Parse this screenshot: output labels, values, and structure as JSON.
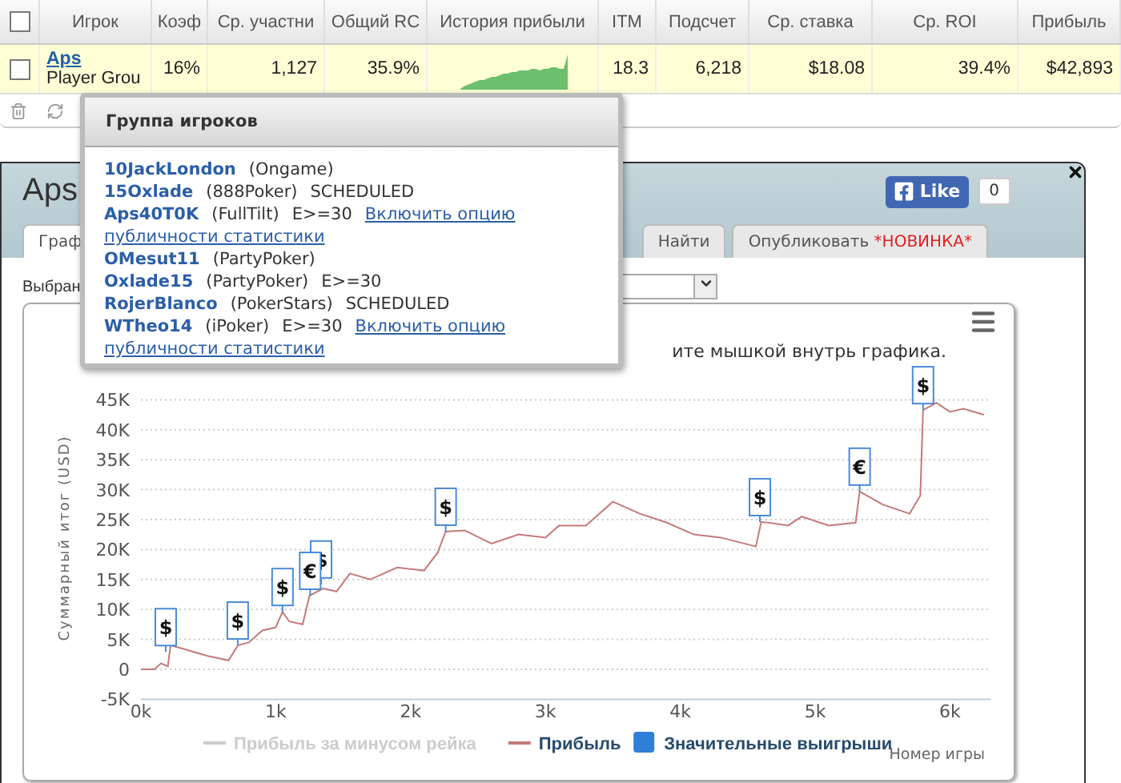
{
  "table": {
    "header_checkbox": {
      "checked": false
    },
    "columns": [
      "Игрок",
      "Коэф",
      "Ср. участни",
      "Общий RC",
      "История прибыли",
      "ITM",
      "Подсчет",
      "Ср. ставка",
      "Ср. ROI",
      "Прибыль"
    ],
    "rows": [
      {
        "checked": false,
        "player": "Aps",
        "group": "Player Grou",
        "coef": "16%",
        "avg_players": "1,127",
        "total_roi": "35.9%",
        "itm": "18.3",
        "count": "6,218",
        "avg_stake": "$18.08",
        "avg_roi": "39.4%",
        "profit": "$42,893"
      }
    ]
  },
  "popover": {
    "title": "Группа игроков",
    "items": [
      {
        "name": "10JackLondon",
        "network": "(Ongame)"
      },
      {
        "name": "15Oxlade",
        "network": "(888Poker)",
        "note": "SCHEDULED"
      },
      {
        "name": "Aps40T0K",
        "network": "(FullTilt)",
        "note": "E>=30",
        "link": [
          "Включить опцию",
          "публичности статистики"
        ]
      },
      {
        "name": "OMesut11",
        "network": "(PartyPoker)"
      },
      {
        "name": "Oxlade15",
        "network": "(PartyPoker)",
        "note": "E>=30"
      },
      {
        "name": "RojerBlanco",
        "network": "(PokerStars)",
        "note": "SCHEDULED"
      },
      {
        "name": "WTheo14",
        "network": "(iPoker)",
        "note": "E>=30",
        "link": [
          "Включить опцию",
          "публичности статистики"
        ]
      }
    ]
  },
  "dialog": {
    "title": "Aps",
    "like": {
      "label": "Like",
      "count": "0"
    },
    "tabs": [
      {
        "label": "Граф",
        "selected": true
      },
      {
        "label": "Найти",
        "selected": false
      },
      {
        "label": "Опубликовать",
        "badge": "*НОВИНКА*",
        "selected": false
      }
    ],
    "select_label": "Выбран",
    "chart": {
      "hint": "ите мышкой внутрь графика.",
      "legend": [
        {
          "kind": "line",
          "label": "Прибыль за минусом рейка",
          "color": "#cccccc",
          "visible": false
        },
        {
          "kind": "series",
          "visible": true
        },
        {
          "kind": "flag",
          "label": "Значительные выигрыши",
          "color": "#2f7ed8",
          "visible": true
        }
      ],
      "chart_data": {
        "type": "line",
        "grid": true,
        "xlabel": "Номер игры",
        "ylabel": "Суммарный итог (USD)",
        "x": [
          0,
          100,
          150,
          200,
          220,
          300,
          500,
          650,
          720,
          800,
          900,
          1000,
          1050,
          1100,
          1200,
          1250,
          1350,
          1450,
          1550,
          1700,
          1900,
          2100,
          2200,
          2260,
          2400,
          2600,
          2800,
          3000,
          3100,
          3300,
          3500,
          3700,
          3900,
          4100,
          4300,
          4560,
          4600,
          4650,
          4800,
          4900,
          5100,
          5300,
          5330,
          5500,
          5700,
          5780,
          5800,
          5900,
          6000,
          6100,
          6250
        ],
        "series": [
          {
            "name": "Прибыль",
            "color": "#c47a7a",
            "values": [
              0,
              0,
              1000,
              500,
              4000,
              3500,
              2200,
              1500,
              4000,
              4500,
              6500,
              7000,
              9600,
              8000,
              7500,
              12300,
              13500,
              13000,
              16000,
              15000,
              17000,
              16500,
              19500,
              23000,
              23200,
              21000,
              22500,
              22000,
              24000,
              24000,
              28000,
              26000,
              24500,
              22500,
              22000,
              20500,
              24600,
              24500,
              24000,
              25500,
              24000,
              24500,
              29700,
              27500,
              26000,
              29000,
              43300,
              44500,
              43000,
              43500,
              42500
            ]
          }
        ],
        "xlim": [
          0,
          6300
        ],
        "ylim": [
          -5000,
          45000
        ],
        "xticks": [
          {
            "value": 0,
            "label": "0k"
          },
          {
            "value": 1000,
            "label": "1k"
          },
          {
            "value": 2000,
            "label": "2k"
          },
          {
            "value": 3000,
            "label": "3k"
          },
          {
            "value": 4000,
            "label": "4k"
          },
          {
            "value": 5000,
            "label": "5k"
          },
          {
            "value": 6000,
            "label": "6k"
          }
        ],
        "yticks": [
          {
            "value": -5000,
            "label": "-5K"
          },
          {
            "value": 0,
            "label": "0"
          },
          {
            "value": 5000,
            "label": "5K"
          },
          {
            "value": 10000,
            "label": "10K"
          },
          {
            "value": 15000,
            "label": "15K"
          },
          {
            "value": 20000,
            "label": "20K"
          },
          {
            "value": 25000,
            "label": "25K"
          },
          {
            "value": 30000,
            "label": "30K"
          },
          {
            "value": 35000,
            "label": "35K"
          },
          {
            "value": 40000,
            "label": "40K"
          },
          {
            "value": 45000,
            "label": "45K"
          }
        ],
        "annotations": [
          {
            "x": 184,
            "y": 2900,
            "text": "$"
          },
          {
            "x": 718,
            "y": 4000,
            "text": "$"
          },
          {
            "x": 1050,
            "y": 9600,
            "text": "$"
          },
          {
            "x": 1336,
            "y": 14200,
            "text": "$"
          },
          {
            "x": 1255,
            "y": 12300,
            "text": "€"
          },
          {
            "x": 2260,
            "y": 23000,
            "text": "$"
          },
          {
            "x": 4590,
            "y": 24600,
            "text": "$"
          },
          {
            "x": 5330,
            "y": 29700,
            "text": "€"
          },
          {
            "x": 5800,
            "y": 43300,
            "text": "$"
          }
        ]
      }
    }
  }
}
